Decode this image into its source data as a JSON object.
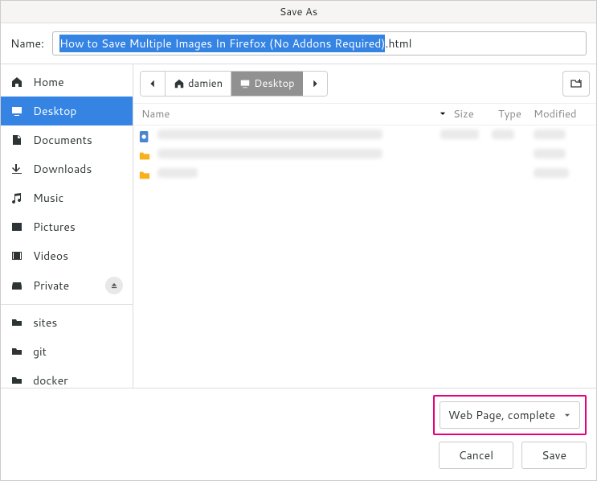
{
  "title": "Save As",
  "name_row": {
    "label": "Name:",
    "value_selected": "How to Save Multiple Images In Firefox (No Addons Required)",
    "extension": ".html"
  },
  "sidebar": {
    "places": [
      {
        "id": "home",
        "label": "Home",
        "icon": "home"
      },
      {
        "id": "desktop",
        "label": "Desktop",
        "icon": "desktop",
        "selected": true
      },
      {
        "id": "documents",
        "label": "Documents",
        "icon": "documents"
      },
      {
        "id": "downloads",
        "label": "Downloads",
        "icon": "downloads"
      },
      {
        "id": "music",
        "label": "Music",
        "icon": "music"
      },
      {
        "id": "pictures",
        "label": "Pictures",
        "icon": "pictures"
      },
      {
        "id": "videos",
        "label": "Videos",
        "icon": "videos"
      },
      {
        "id": "private",
        "label": "Private",
        "icon": "drive",
        "eject": true
      }
    ],
    "bookmarks": [
      {
        "id": "sites",
        "label": "sites",
        "icon": "folder"
      },
      {
        "id": "git",
        "label": "git",
        "icon": "folder"
      },
      {
        "id": "docker",
        "label": "docker",
        "icon": "folder"
      }
    ]
  },
  "pathbar": {
    "segments": [
      {
        "id": "home",
        "label": "damien",
        "icon": "home"
      },
      {
        "id": "desktop",
        "label": "Desktop",
        "icon": "desktop",
        "current": true
      }
    ]
  },
  "columns": {
    "name": "Name",
    "size": "Size",
    "type": "Type",
    "modified": "Modified"
  },
  "files": [
    {
      "kind": "doc"
    },
    {
      "kind": "folder"
    },
    {
      "kind": "folder"
    }
  ],
  "format": {
    "label": "Web Page, complete"
  },
  "actions": {
    "cancel": "Cancel",
    "save": "Save"
  }
}
